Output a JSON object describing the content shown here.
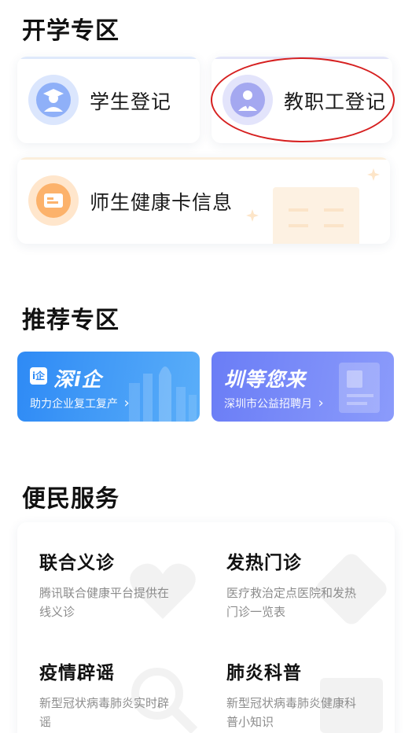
{
  "sections": {
    "enrollment_title": "开学专区",
    "recommend_title": "推荐专区",
    "services_title": "便民服务"
  },
  "enrollment": {
    "student_register": "学生登记",
    "staff_register": "教职工登记",
    "health_card": "师生健康卡信息"
  },
  "banners": [
    {
      "title": "深i企",
      "subtitle": "助力企业复工复产",
      "badge": "i企",
      "arrow": "›",
      "color": "#3d95f6"
    },
    {
      "title": "圳等您来",
      "subtitle": "深圳市公益招聘月",
      "arrow": "›",
      "color": "#6f82f7"
    }
  ],
  "services": [
    {
      "title": "联合义诊",
      "desc": "腾讯联合健康平台提供在线义诊",
      "icon": "heart-pulse-icon"
    },
    {
      "title": "发热门诊",
      "desc": "医疗救治定点医院和发热门诊一览表",
      "icon": "medical-cross-icon"
    },
    {
      "title": "疫情辟谣",
      "desc": "新型冠状病毒肺炎实时辟谣",
      "icon": "magnifier-icon"
    },
    {
      "title": "肺炎科普",
      "desc": "新型冠状病毒肺炎健康科普小知识",
      "icon": "book-icon"
    }
  ],
  "colors": {
    "student_icon_bg": "#dbe6fd",
    "staff_icon_bg": "#e3e4fb",
    "health_icon_bg": "#ffe6cc",
    "highlight": "#d62020"
  }
}
